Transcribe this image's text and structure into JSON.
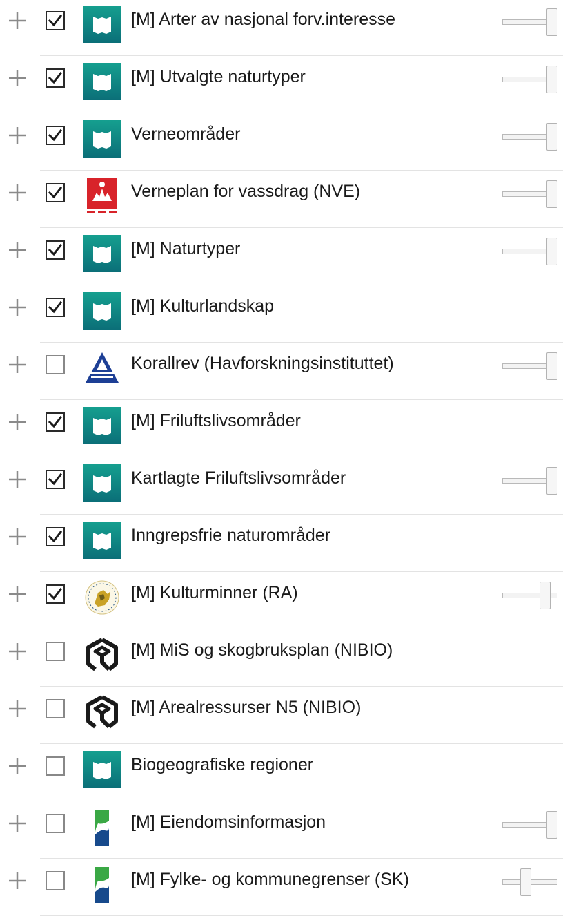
{
  "layers": [
    {
      "label": "[M] Arter av nasjonal forv.interesse",
      "checked": true,
      "icon": "miljodirektoratet-icon",
      "opacity": 1.0
    },
    {
      "label": "[M] Utvalgte naturtyper",
      "checked": true,
      "icon": "miljodirektoratet-icon",
      "opacity": 1.0
    },
    {
      "label": "Verneområder",
      "checked": true,
      "icon": "miljodirektoratet-icon",
      "opacity": 1.0
    },
    {
      "label": "Verneplan for vassdrag (NVE)",
      "checked": true,
      "icon": "nve-icon",
      "opacity": 1.0
    },
    {
      "label": "[M] Naturtyper",
      "checked": true,
      "icon": "miljodirektoratet-icon",
      "opacity": 1.0
    },
    {
      "label": "[M] Kulturlandskap",
      "checked": true,
      "icon": "miljodirektoratet-icon",
      "opacity": null
    },
    {
      "label": "Korallrev (Havforskningsinstituttet)",
      "checked": false,
      "icon": "havforskningsinstituttet-icon",
      "opacity": 1.0
    },
    {
      "label": "[M] Friluftslivsområder",
      "checked": true,
      "icon": "miljodirektoratet-icon",
      "opacity": null
    },
    {
      "label": "Kartlagte Friluftslivsområder",
      "checked": true,
      "icon": "miljodirektoratet-icon",
      "opacity": 1.0
    },
    {
      "label": "Inngrepsfrie naturområder",
      "checked": true,
      "icon": "miljodirektoratet-icon",
      "opacity": null
    },
    {
      "label": "[M] Kulturminner (RA)",
      "checked": true,
      "icon": "riksantikvaren-icon",
      "opacity": 0.85
    },
    {
      "label": "[M] MiS og skogbruksplan (NIBIO)",
      "checked": false,
      "icon": "nibio-icon",
      "opacity": null
    },
    {
      "label": "[M] Arealressurser N5 (NIBIO)",
      "checked": false,
      "icon": "nibio-icon",
      "opacity": null
    },
    {
      "label": "Biogeografiske regioner",
      "checked": false,
      "icon": "miljodirektoratet-icon",
      "opacity": null
    },
    {
      "label": "[M] Eiendomsinformasjon",
      "checked": false,
      "icon": "kartverket-icon",
      "opacity": 1.0
    },
    {
      "label": "[M] Fylke- og kommunegrenser (SK)",
      "checked": false,
      "icon": "kartverket-icon",
      "opacity": 0.4
    }
  ],
  "colors": {
    "miljodirektoratet": "#0f8a86",
    "nve": "#d8232a",
    "havforskning": "#1d3f95",
    "kartverket_green": "#3aa845",
    "kartverket_blue": "#174a8c",
    "riksantikvaren": "#c9a227",
    "text": "#1a1a1a",
    "divider": "#e3e3e3"
  }
}
